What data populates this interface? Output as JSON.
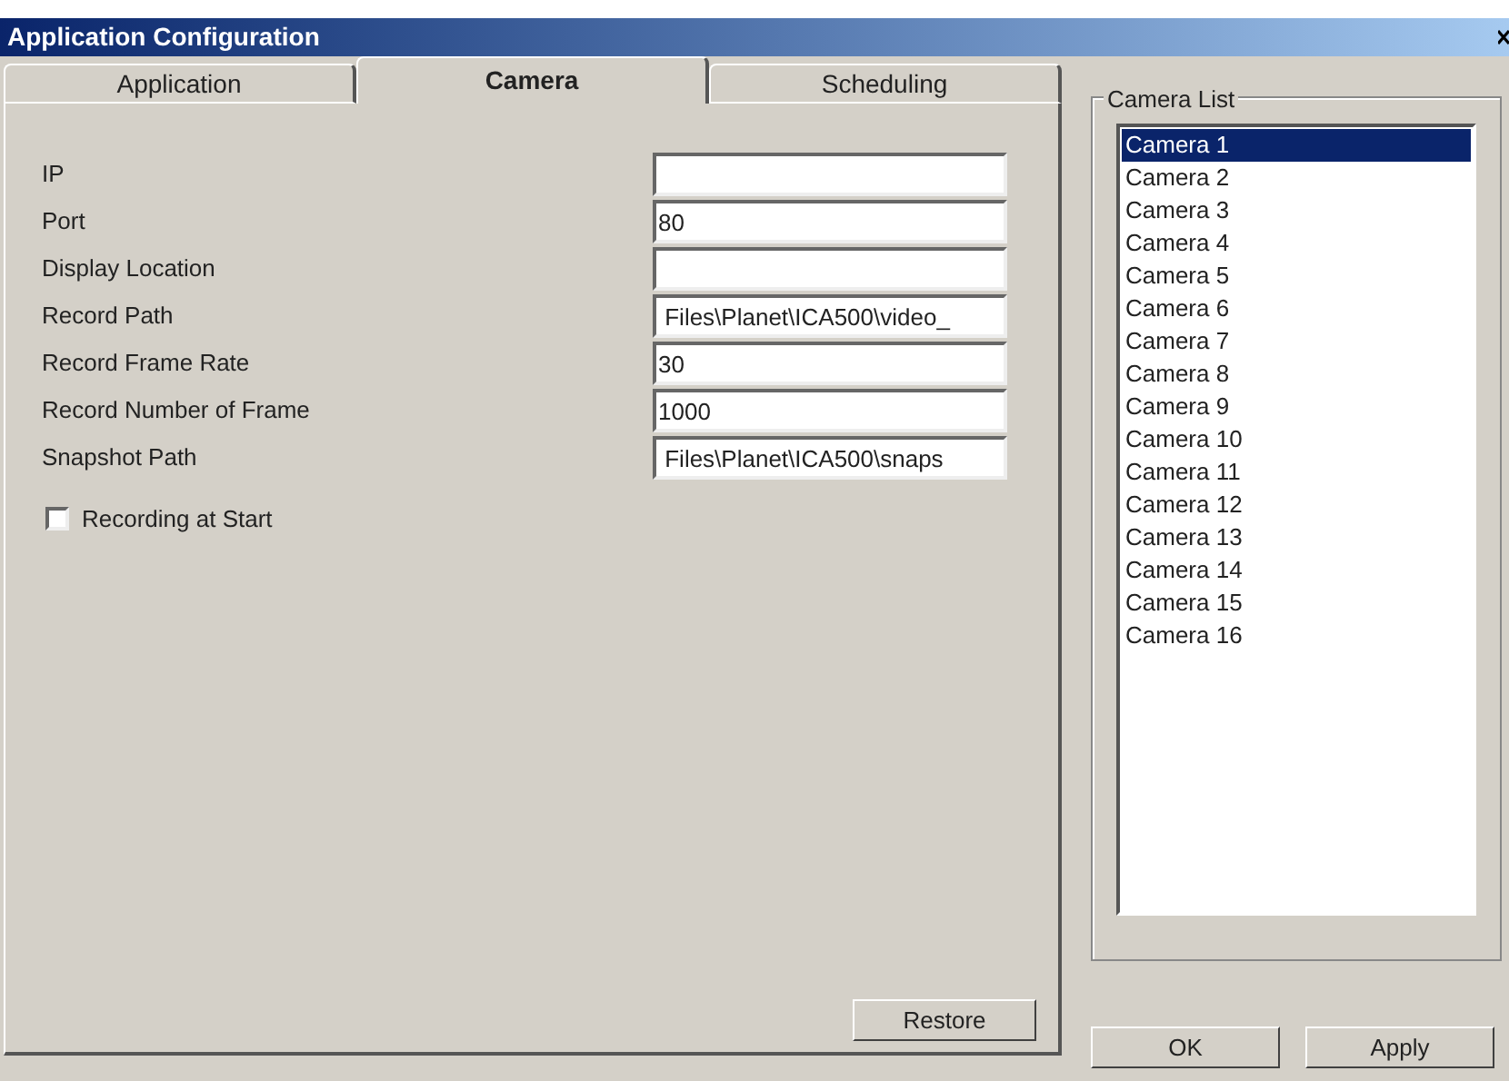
{
  "window": {
    "title": "Application Configuration"
  },
  "tabs": [
    {
      "label": "Application",
      "selected": false
    },
    {
      "label": "Camera",
      "selected": true
    },
    {
      "label": "Scheduling",
      "selected": false
    }
  ],
  "fields": [
    {
      "label": "IP"
    },
    {
      "label": "Port",
      "value": "80"
    },
    {
      "label": "Display Location"
    },
    {
      "label": "Record Path",
      "value": " Files\\Planet\\ICA500\\video_"
    },
    {
      "label": "Record Frame Rate",
      "value": "30"
    },
    {
      "label": "Record Number of Frame",
      "value": "1000"
    },
    {
      "label": "Snapshot Path",
      "value": " Files\\Planet\\ICA500\\snaps"
    }
  ],
  "recording_at_start": {
    "label": "Recording at Start",
    "checked": false
  },
  "restore_button": "Restore",
  "camera_list": {
    "title": "Camera List",
    "items": [
      {
        "label": "Camera 1",
        "selected": true
      },
      {
        "label": "Camera 2",
        "selected": false
      },
      {
        "label": "Camera 3",
        "selected": false
      },
      {
        "label": "Camera 4",
        "selected": false
      },
      {
        "label": "Camera 5",
        "selected": false
      },
      {
        "label": "Camera 6",
        "selected": false
      },
      {
        "label": "Camera 7",
        "selected": false
      },
      {
        "label": "Camera 8",
        "selected": false
      },
      {
        "label": "Camera 9",
        "selected": false
      },
      {
        "label": "Camera 10",
        "selected": false
      },
      {
        "label": "Camera 11",
        "selected": false
      },
      {
        "label": "Camera 12",
        "selected": false
      },
      {
        "label": "Camera 13",
        "selected": false
      },
      {
        "label": "Camera 14",
        "selected": false
      },
      {
        "label": "Camera 15",
        "selected": false
      },
      {
        "label": "Camera 16",
        "selected": false
      }
    ]
  },
  "buttons": [
    "OK",
    "Apply"
  ]
}
